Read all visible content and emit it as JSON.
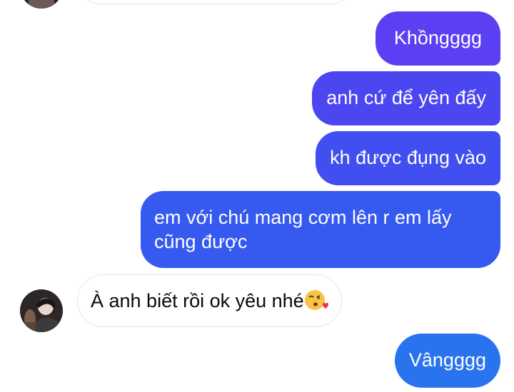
{
  "colors": {
    "sent_bubble_top": "#5b3ff2",
    "sent_bubble_mid": "#3f4ef0",
    "sent_bubble_bottom": "#2a6bef",
    "received_bubble": "#ffffff",
    "received_border": "#e6e7eb"
  },
  "messages": [
    {
      "id": "m1",
      "from": "me",
      "text": "Khồngggg"
    },
    {
      "id": "m2",
      "from": "me",
      "text": "anh cứ để yên đấy"
    },
    {
      "id": "m3",
      "from": "me",
      "text": "kh được đụng vào"
    },
    {
      "id": "m4",
      "from": "me",
      "lines": [
        "em với chú mang cơm lên r em lấy",
        "cũng được"
      ]
    },
    {
      "id": "m5",
      "from": "them",
      "text": "À anh biết rồi ok yêu nhé",
      "emoji": "face-blowing-kiss"
    },
    {
      "id": "m6",
      "from": "me",
      "text": "Vângggg"
    }
  ]
}
